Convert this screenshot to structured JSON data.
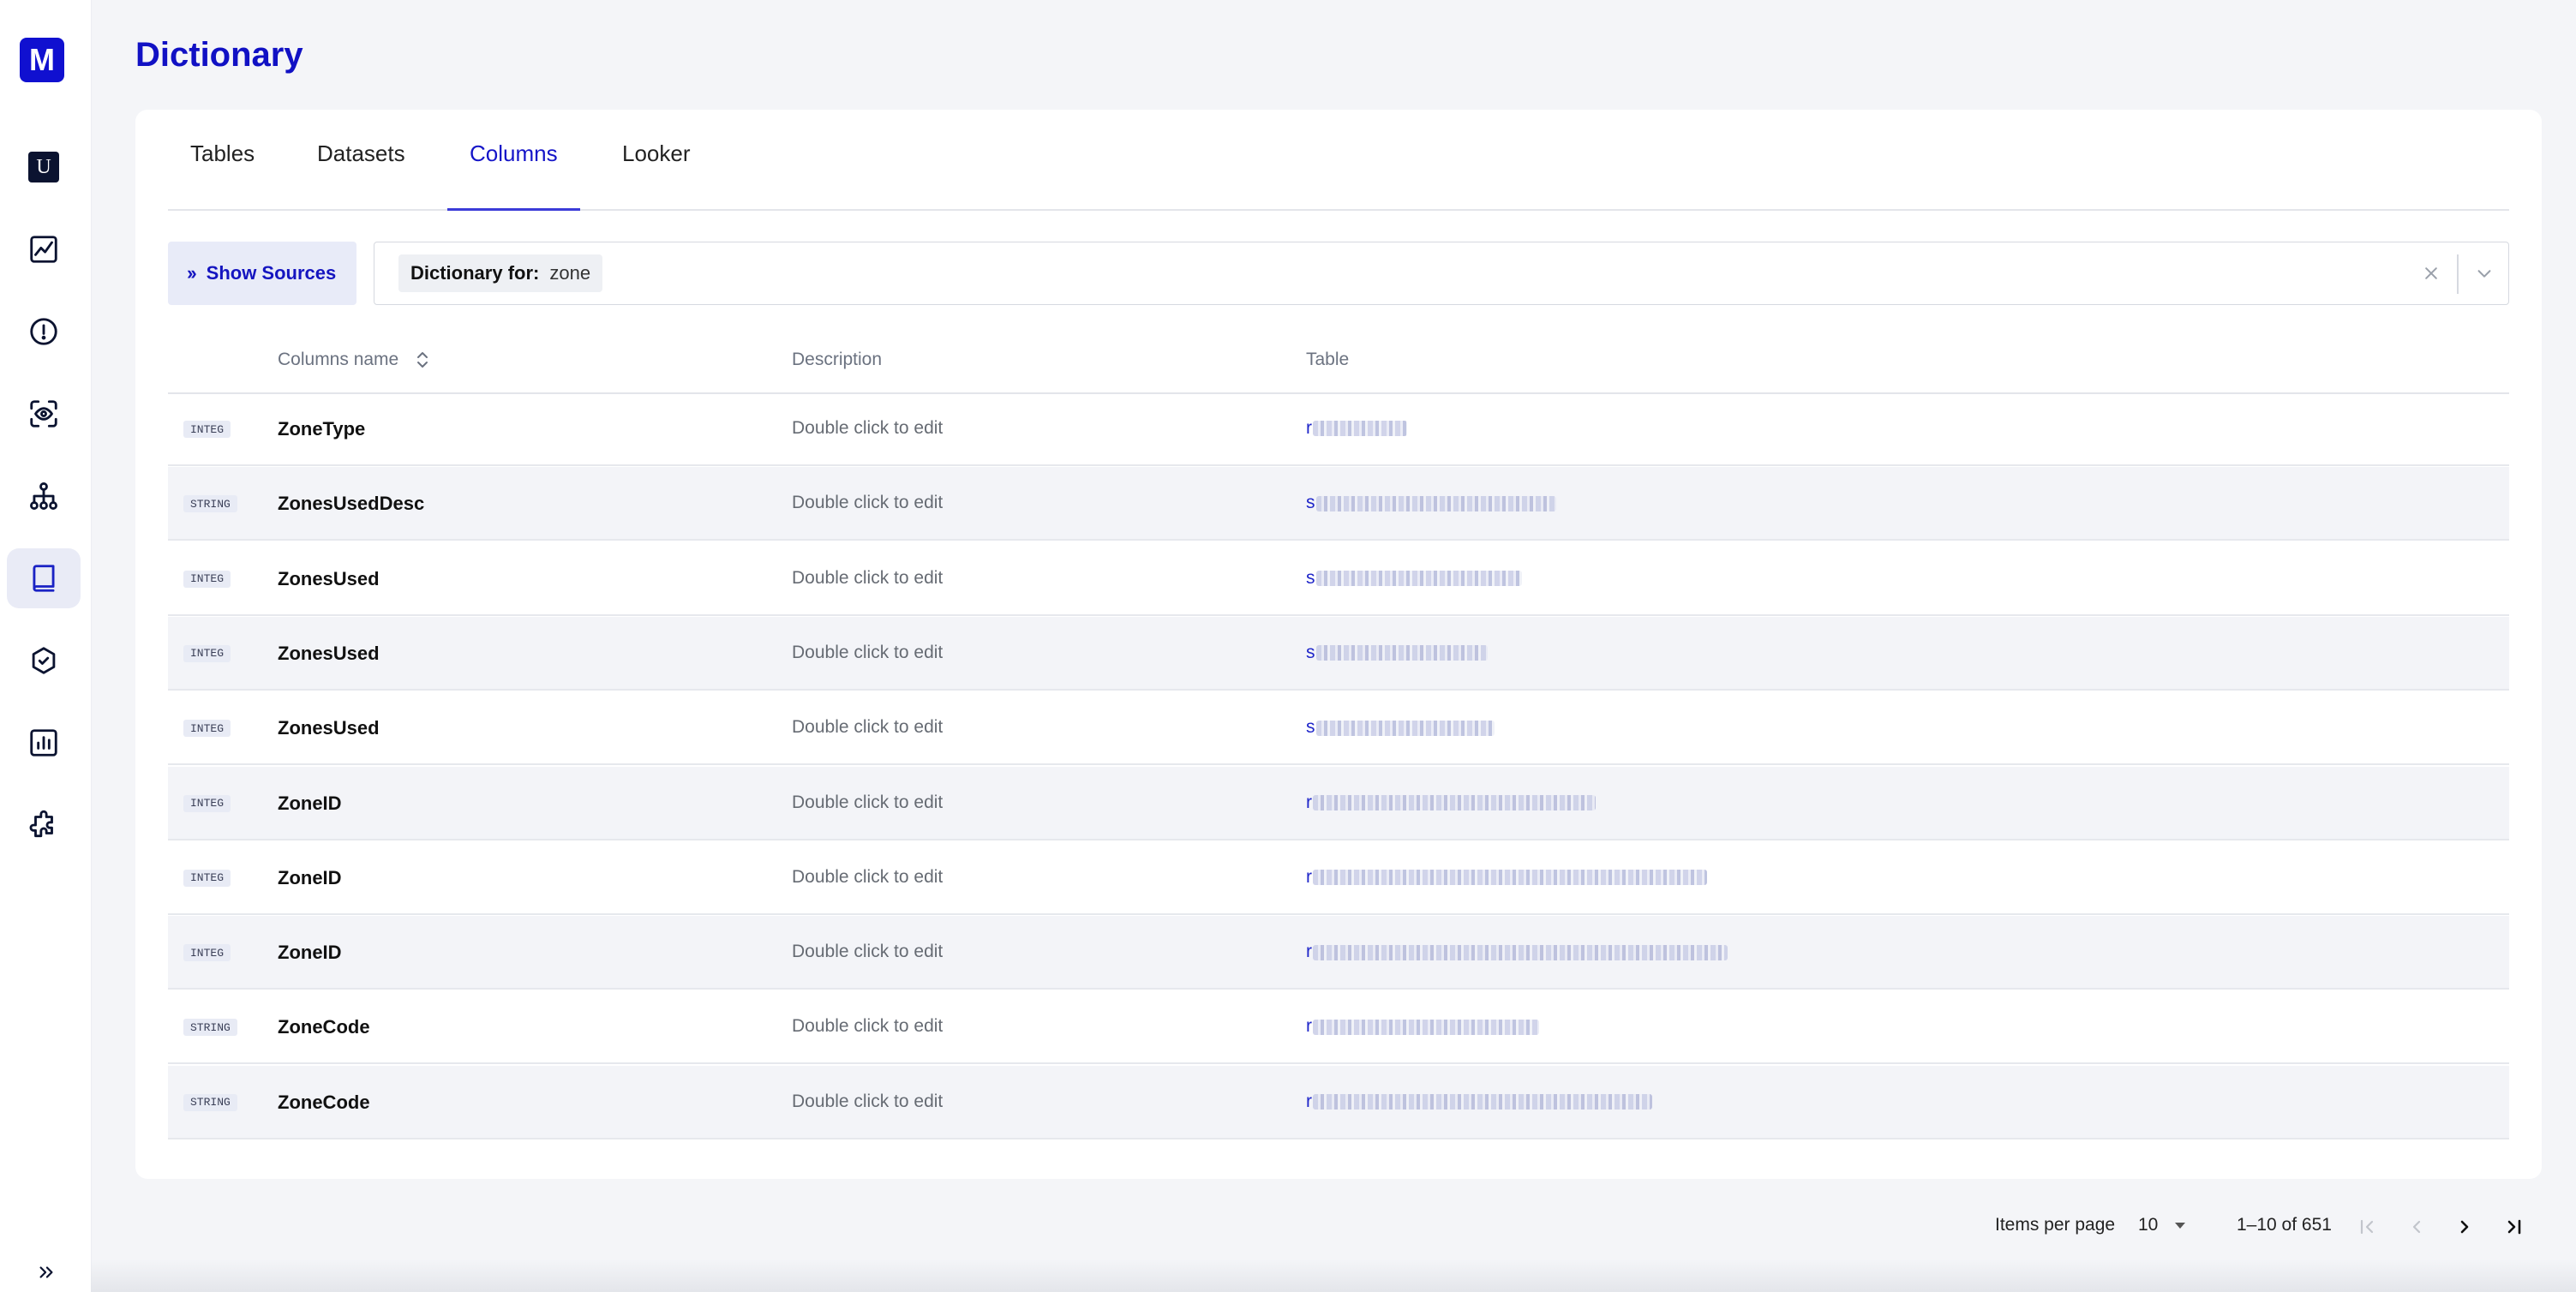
{
  "sidebar": {
    "logo_letter": "M",
    "avatar_letter": "U",
    "items": [
      {
        "icon": "chart-line-icon"
      },
      {
        "icon": "alert-circle-icon"
      },
      {
        "icon": "eye-scan-icon"
      },
      {
        "icon": "hierarchy-icon"
      },
      {
        "icon": "book-icon",
        "active": true
      },
      {
        "icon": "shield-check-icon"
      },
      {
        "icon": "bar-chart-icon"
      },
      {
        "icon": "puzzle-icon"
      }
    ],
    "expand_icon": "double-chevron-right-icon"
  },
  "page": {
    "title": "Dictionary"
  },
  "tabs": [
    {
      "label": "Tables"
    },
    {
      "label": "Datasets"
    },
    {
      "label": "Columns",
      "active": true
    },
    {
      "label": "Looker"
    }
  ],
  "toolbar": {
    "show_sources_label": "Show Sources",
    "chip_key": "Dictionary for:",
    "chip_value": "zone"
  },
  "table": {
    "headers": {
      "name": "Columns name",
      "description": "Description",
      "table": "Table"
    },
    "rows": [
      {
        "type": "INTEG",
        "name": "ZoneType",
        "description": "Double click to edit",
        "table_prefix": "r"
      },
      {
        "type": "STRING",
        "name": "ZonesUsedDesc",
        "description": "Double click to edit",
        "table_prefix": "s"
      },
      {
        "type": "INTEG",
        "name": "ZonesUsed",
        "description": "Double click to edit",
        "table_prefix": "s"
      },
      {
        "type": "INTEG",
        "name": "ZonesUsed",
        "description": "Double click to edit",
        "table_prefix": "s"
      },
      {
        "type": "INTEG",
        "name": "ZonesUsed",
        "description": "Double click to edit",
        "table_prefix": "s"
      },
      {
        "type": "INTEG",
        "name": "ZoneID",
        "description": "Double click to edit",
        "table_prefix": "r"
      },
      {
        "type": "INTEG",
        "name": "ZoneID",
        "description": "Double click to edit",
        "table_prefix": "r"
      },
      {
        "type": "INTEG",
        "name": "ZoneID",
        "description": "Double click to edit",
        "table_prefix": "r"
      },
      {
        "type": "STRING",
        "name": "ZoneCode",
        "description": "Double click to edit",
        "table_prefix": "r"
      },
      {
        "type": "STRING",
        "name": "ZoneCode",
        "description": "Double click to edit",
        "table_prefix": "r"
      }
    ]
  },
  "pagination": {
    "items_per_page_label": "Items per page",
    "items_per_page_value": "10",
    "range_label": "1–10 of 651"
  }
}
